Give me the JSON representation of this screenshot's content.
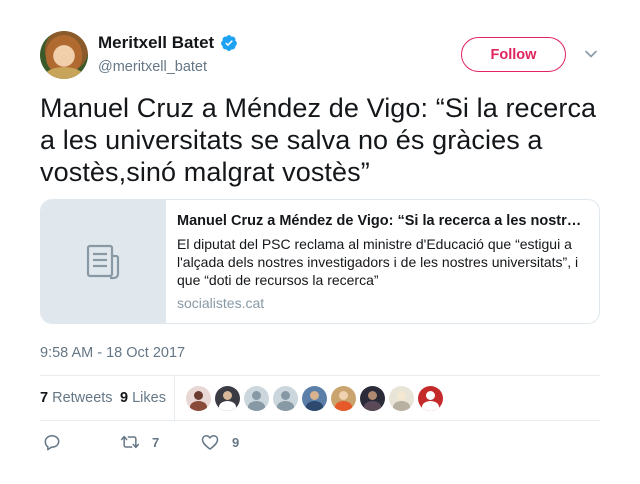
{
  "author": {
    "display_name": "Meritxell Batet",
    "handle": "@meritxell_batet",
    "verified": true,
    "icons": {
      "verified": "verified-badge-icon",
      "caret": "chevron-down-icon"
    }
  },
  "follow_label": "Follow",
  "tweet": {
    "text": "Manuel Cruz a Méndez de Vigo: “Si la recerca a les universitats se salva no és gràcies a vostès,sinó malgrat vostès”"
  },
  "card": {
    "title": "Manuel Cruz a Méndez de Vigo: “Si la recerca a les nostres universitats se salva no és gràcies a vostès, sinó malgrat vostès”",
    "description": "El diputat del PSC reclama al ministre d'Educació que “estigui a l'alçada dels nostres investigadors i de les nostres universitats”, i que “doti de recursos la recerca”",
    "domain": "socialistes.cat",
    "thumb_icon": "document-icon"
  },
  "timestamp": "9:58 AM - 18 Oct 2017",
  "stats": {
    "retweets_count": "7",
    "retweets_label": "Retweets",
    "likes_count": "9",
    "likes_label": "Likes"
  },
  "likers": [
    {
      "name": "liker-avatar-1",
      "bg": "#e8d7d4",
      "head": "#6b3a2e",
      "body": "#8a4a3a"
    },
    {
      "name": "liker-avatar-2",
      "bg": "#3b3b44",
      "head": "#d9b79a",
      "body": "#ffffff"
    },
    {
      "name": "liker-avatar-3",
      "bg": "#ccd6dd",
      "head": "#8899a6",
      "body": "#8899a6"
    },
    {
      "name": "liker-avatar-4",
      "bg": "#ccd6dd",
      "head": "#8899a6",
      "body": "#8899a6"
    },
    {
      "name": "liker-avatar-5",
      "bg": "#5b7fa8",
      "head": "#d8b38f",
      "body": "#2d4a6e"
    },
    {
      "name": "liker-avatar-6",
      "bg": "#c9a46e",
      "head": "#f0d2b0",
      "body": "#e65a2a"
    },
    {
      "name": "liker-avatar-7",
      "bg": "#2a2a38",
      "head": "#b08a70",
      "body": "#5a4a58"
    },
    {
      "name": "liker-avatar-8",
      "bg": "#e8e4d8",
      "head": "#f5e8d0",
      "body": "#b8b0a0"
    },
    {
      "name": "liker-avatar-9",
      "bg": "#c42a2a",
      "head": "#ffffff",
      "body": "#ffffff"
    }
  ],
  "actions": {
    "reply_icon": "reply-icon",
    "retweet_icon": "retweet-icon",
    "retweet_count": "7",
    "like_icon": "heart-icon",
    "like_count": "9"
  },
  "colors": {
    "accent": "#e0245e",
    "verified": "#1da1f2",
    "muted_text": "#657786",
    "border": "#e1e8ed"
  }
}
